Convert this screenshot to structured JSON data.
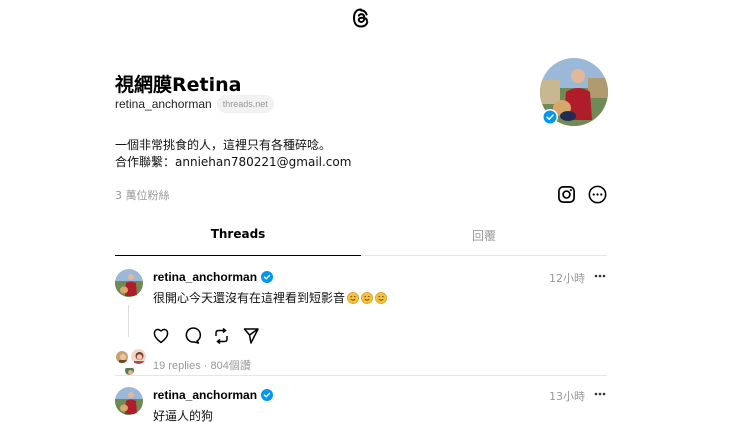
{
  "header": {
    "logo_icon": "threads-logo-icon"
  },
  "profile": {
    "name": "視網膜Retina",
    "handle": "retina_anchorman",
    "domain_pill": "threads.net",
    "bio_line1": "一個非常挑食的人，這裡只有各種碎唸。",
    "bio_line2": "合作聯繫：anniehan780221@gmail.com",
    "followers": "3 萬位粉絲",
    "verified": true
  },
  "tabs": [
    {
      "label": "Threads",
      "active": true
    },
    {
      "label": "回覆",
      "active": false
    }
  ],
  "posts": [
    {
      "user": "retina_anchorman",
      "time": "12小時",
      "text": "很開心今天還沒有在這裡看到短影音",
      "emoji_count": 3,
      "replies": "19 replies",
      "separator": "·",
      "views": "804個讚"
    },
    {
      "user": "retina_anchorman",
      "time": "13小時",
      "text": "好逼人的狗"
    }
  ],
  "colors": {
    "verified": "#0095f6",
    "muted": "#999999",
    "accent": "#000000"
  }
}
